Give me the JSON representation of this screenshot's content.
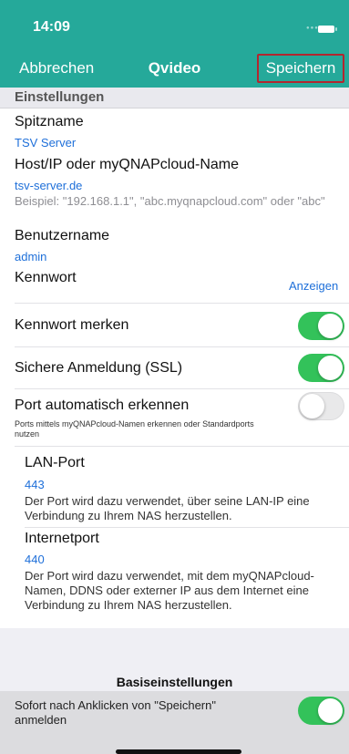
{
  "status_bar": {
    "time": "14:09"
  },
  "nav": {
    "cancel": "Abbrechen",
    "title": "Qvideo",
    "save": "Speichern"
  },
  "section": {
    "header": "Einstellungen"
  },
  "nickname": {
    "label": "Spitzname",
    "value": "TSV Server"
  },
  "host": {
    "label": "Host/IP oder myQNAPcloud-Name",
    "value": "tsv-server.de",
    "hint": "Beispiel: \"192.168.1.1\", \"abc.myqnapcloud.com\" oder \"abc\""
  },
  "username": {
    "label": "Benutzername",
    "value": "admin"
  },
  "password": {
    "label": "Kennwort",
    "show": "Anzeigen"
  },
  "remember_password": {
    "label": "Kennwort merken",
    "enabled": true
  },
  "ssl": {
    "label": "Sichere Anmeldung (SSL)",
    "enabled": true
  },
  "auto_port": {
    "label": "Port automatisch erkennen",
    "hint": "Ports mittels myQNAPcloud-Namen erkennen oder Standardports nutzen",
    "enabled": false
  },
  "lan_port": {
    "label": "LAN-Port",
    "value": "443",
    "description": "Der Port wird dazu verwendet, über seine LAN-IP eine Verbindung zu Ihrem NAS herzustellen."
  },
  "internet_port": {
    "label": "Internetport",
    "value": "440",
    "description": "Der Port wird dazu verwendet, mit dem myQNAPcloud-Namen, DDNS oder externer IP aus dem Internet eine Verbindung zu Ihrem NAS herzustellen."
  },
  "basic_settings": {
    "title": "Basiseinstellungen",
    "login_after_save_label": "Sofort nach Anklicken von \"Speichern\" anmelden",
    "login_after_save_enabled": true
  },
  "colors": {
    "accent": "#25a99a",
    "link": "#1e6fd9",
    "toggle_on": "#33c25a",
    "highlight_border": "#b3262f"
  }
}
